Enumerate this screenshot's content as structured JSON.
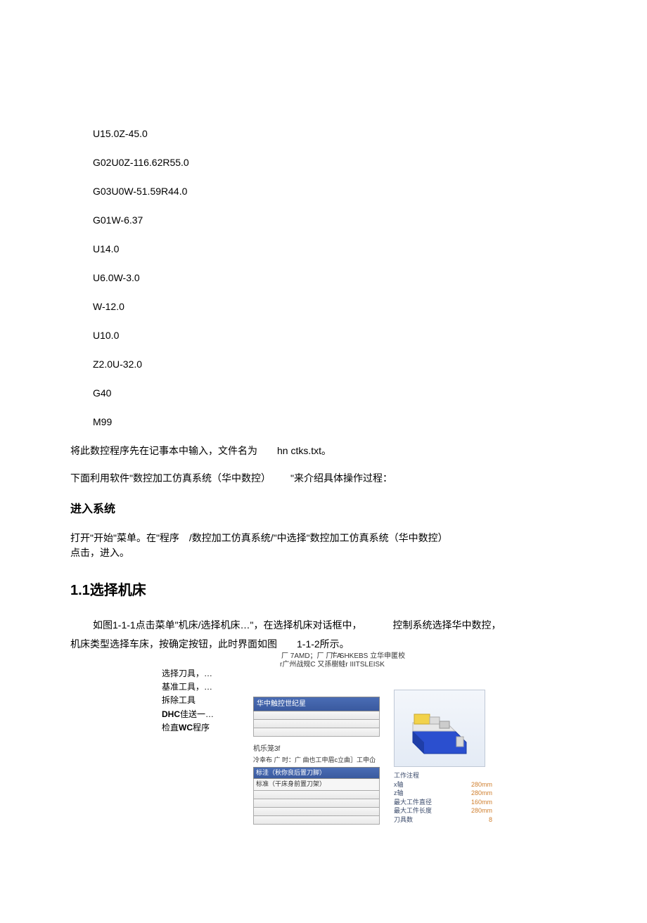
{
  "code": {
    "l1": "U15.0Z-45.0",
    "l2": "G02U0Z-116.62R55.0",
    "l3": "G03U0W-51.59R44.0",
    "l4": "G01W-6.37",
    "l5": "U14.0",
    "l6": "U6.0W-3.0",
    "l7": "W-12.0",
    "l8": "U10.0",
    "l9": "Z2.0U-32.0",
    "l10": "G40",
    "l11": "M99"
  },
  "p1a": "将此数控程序先在记事本中输入，文件名为",
  "p1b": "hn ctks.txt。",
  "p2a": "下面利用软件\"数控加工仿真系统（华中数控）",
  "p2b": "\"来介绍具体操作过程：",
  "h2": "进入系统",
  "p3a": "打开\"开始\"菜单。在\"程序",
  "p3b": "/数控加工仿真系统/\"中选择\"数控加工仿真系统（华中数控）",
  "p3c": "点击，进入。",
  "h1": "1.1选择机床",
  "p4a": "如图1-1-1点击菜单\"机床/选择机床…\"，在选择机床对话框中，",
  "p4b": "控制系统选择华中数控，",
  "p5a": "机床类型选择车床，按确定按钮，此时界面如图",
  "p5b": "1-1-2所示。",
  "cap1a": "厂 7AMD；厂 厂FA",
  "cap1b": "广 SHKEBS 立华申匿校",
  "cap2": "r广州战规C 又孫樹蛙r IIITSLEISK",
  "menu": {
    "m1": "选择刀具，…",
    "m2": "基准工具，…",
    "m3": "拆除工具",
    "m4a": "DHC",
    "m4b": "佳送一…",
    "m5a": "检直",
    "m5b": "WC",
    "m5c": "程序"
  },
  "panel": {
    "h1": "华中触控世纪星",
    "lab1": "机乐笼3f",
    "sub1": "冷幸布 广 时：广 曲也工申眉c立曲］工申仚",
    "sel": "标洼（秋你良后置刀脚）",
    "row": "标准（干床身前置刀架）"
  },
  "spec": {
    "title": "工作注程",
    "r1k": "x轴",
    "r1v": "280mm",
    "r2k": "z轴",
    "r2v": "280mm",
    "r3k": "最大工件直径",
    "r3v": "160mm",
    "r4k": "最大工件长度",
    "r4v": "280mm",
    "r5k": "刀具数",
    "r5v": "8"
  }
}
